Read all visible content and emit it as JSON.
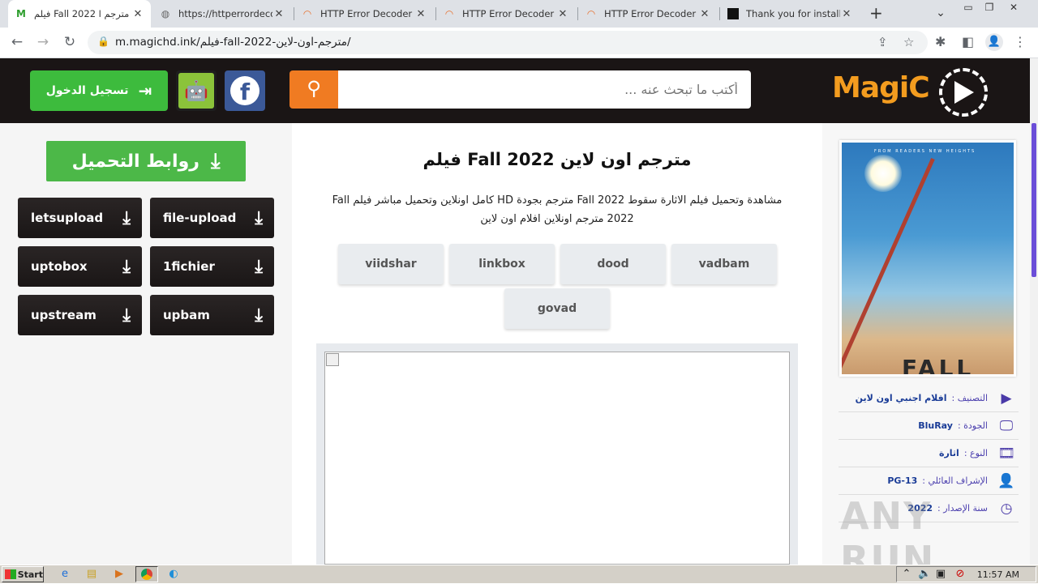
{
  "browser": {
    "tabs": [
      {
        "title": "فيلم Fall 2022 مترجم ا",
        "favicon": "M",
        "active": true
      },
      {
        "title": "https://httperrordecod",
        "favicon": "globe"
      },
      {
        "title": "HTTP Error Decoder",
        "favicon": "rainbow"
      },
      {
        "title": "HTTP Error Decoder",
        "favicon": "rainbow"
      },
      {
        "title": "HTTP Error Decoder",
        "favicon": "rainbow"
      },
      {
        "title": "Thank you for installing",
        "favicon": "square"
      }
    ],
    "url": "m.magichd.ink/فيلم-fall-2022-مترجم-اون-لاين/"
  },
  "site": {
    "logo_text": "MagiC",
    "search_placeholder": "أكتب ما تبحث عنه ...",
    "login_label": "تسجيل الدخول",
    "download_links_label": "روابط التحميل",
    "hosts": [
      {
        "name": "file-upload"
      },
      {
        "name": "letsupload"
      },
      {
        "name": "1fichier"
      },
      {
        "name": "uptobox"
      },
      {
        "name": "upbam"
      },
      {
        "name": "upstream"
      }
    ],
    "movie_title": "فيلم Fall 2022 مترجم اون لاين",
    "description": "مشاهدة وتحميل فيلم الاثارة سقوط Fall 2022 مترجم بجودة HD كامل اونلاين وتحميل مباشر فيلم Fall 2022 مترجم اونلاين افلام اون لاين",
    "servers": [
      "vadbam",
      "dood",
      "linkbox",
      "viidshar",
      "govad"
    ],
    "poster": {
      "tagline": "FROM READERS NEW HEIGHTS",
      "title": "FALL"
    },
    "info": [
      {
        "icon": "play-icon",
        "key": "التصنيف :",
        "value": "افلام اجنبي اون لاين"
      },
      {
        "icon": "monitor-icon",
        "key": "الجودة :",
        "value": "BluRay"
      },
      {
        "icon": "film-icon",
        "key": "النوع :",
        "value": "اثارة"
      },
      {
        "icon": "user-check-icon",
        "key": "الإشراف العائلي :",
        "value": "PG-13"
      },
      {
        "icon": "clock-icon",
        "key": "سنة الإصدار :",
        "value": "2022"
      }
    ],
    "watermark": "ANY RUN"
  },
  "taskbar": {
    "start_label": "Start",
    "clock": "11:57 AM"
  }
}
